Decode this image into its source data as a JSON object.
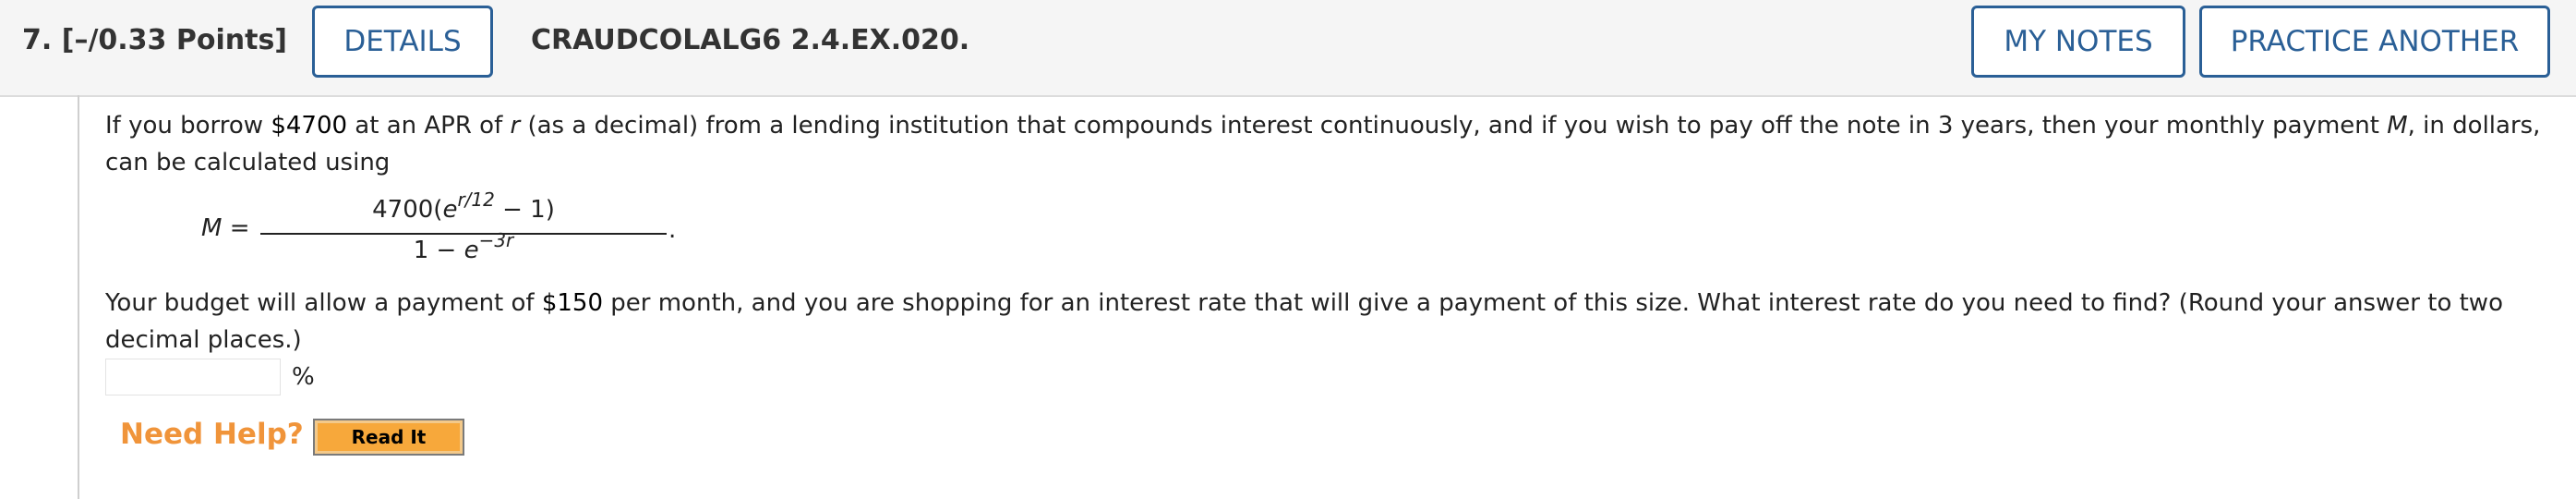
{
  "header": {
    "question_number": "7.",
    "points": "[–/0.33 Points]",
    "details_label": "DETAILS",
    "problem_code": "CRAUDCOLALG6 2.4.EX.020.",
    "my_notes_label": "MY NOTES",
    "practice_another_label": "PRACTICE ANOTHER"
  },
  "question": {
    "p1": {
      "t1": "If you borrow ",
      "amount": "$4700",
      "t2": " at an APR of ",
      "r": "r",
      "t3": " (as a decimal) from a lending institution that compounds interest continuously, and if you wish to pay off the note in 3 years, then your monthly payment ",
      "M": "M",
      "t4": ", in dollars, can be calculated using"
    },
    "formula": {
      "lhs_var": "M",
      "equals": " =",
      "num_prefix": "4700(",
      "num_e": "e",
      "num_exp": "r/12",
      "num_suffix": " − 1)",
      "den_prefix": "1 − ",
      "den_e": "e",
      "den_exp": "−3r",
      "period": "."
    },
    "p2": {
      "t1": "Your budget will allow a payment of ",
      "amount": "$150",
      "t2": " per month, and you are shopping for an interest rate that will give a payment of this size. What interest rate do you need to find? (Round your answer to two decimal places.)"
    },
    "answer": {
      "value": "",
      "unit": "%"
    }
  },
  "help": {
    "label": "Need Help?",
    "read_it_label": "Read It"
  },
  "colors": {
    "accent": "#2a5f96",
    "help_orange": "#f0943a",
    "readit_bg": "#f7a83b",
    "header_bg": "#f5f5f5"
  }
}
